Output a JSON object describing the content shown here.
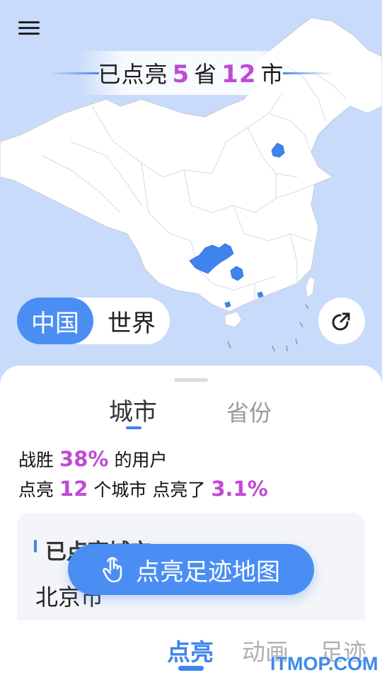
{
  "banner": {
    "prefix": "已点亮",
    "province_count": "5",
    "middle": "省",
    "city_count": "12",
    "suffix": "市"
  },
  "region_toggle": {
    "china": "中国",
    "world": "世界",
    "selected": "中国"
  },
  "icons": {
    "menu": "menu-icon",
    "share": "share-icon",
    "hand": "tap-hand-icon"
  },
  "sheet": {
    "tabs": [
      "城市",
      "省份"
    ],
    "active_tab": "城市",
    "stats": {
      "beat_prefix": "战胜",
      "beat_percent": "38%",
      "beat_suffix": "的用户",
      "lit_prefix": "点亮",
      "lit_cities": "12",
      "lit_middle": "个城市  点亮了",
      "lit_percent": "3.1%"
    },
    "card": {
      "title": "已点亮城市",
      "first_city": "北京市"
    }
  },
  "cta": {
    "label": "点亮足迹地图"
  },
  "bottom_nav": {
    "items": [
      "点亮",
      "动画",
      "足迹"
    ],
    "active": "点亮"
  },
  "watermark": "ITMOP.COM",
  "colors": {
    "accent": "#4a8ef3",
    "highlight": "#c04ad6",
    "map_bg": "#c8dbfb",
    "lit_region": "#3f83ef"
  }
}
